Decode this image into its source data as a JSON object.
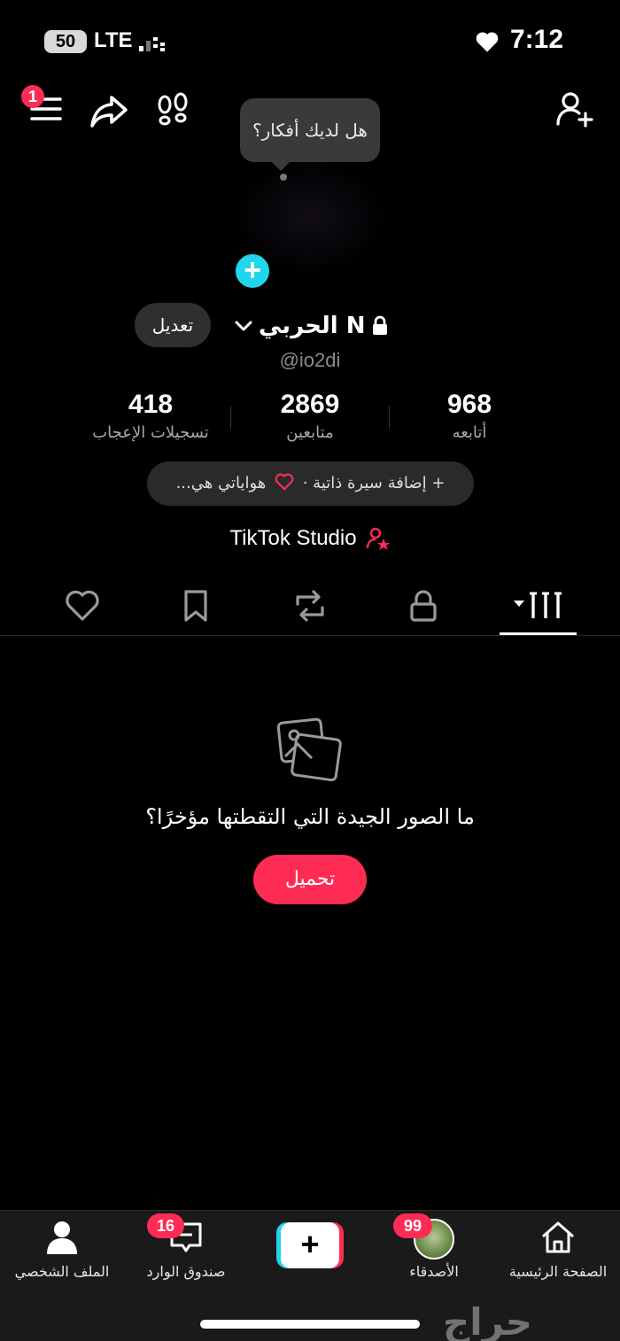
{
  "status_bar": {
    "battery": "50",
    "network": "LTE",
    "time": "7:12"
  },
  "top_bar": {
    "menu_badge": "1"
  },
  "tooltip": {
    "text": "هل لديك أفكار؟"
  },
  "profile": {
    "edit_label": "تعديل",
    "name": "الحربي N",
    "handle": "@io2di"
  },
  "stats": [
    {
      "value": "968",
      "label": "أتابعه"
    },
    {
      "value": "2869",
      "label": "متابعين"
    },
    {
      "value": "418",
      "label": "تسجيلات الإعجاب"
    }
  ],
  "bio_button": {
    "add": "+ إضافة سيرة ذاتية ·",
    "hobbies": "هواياتي هي..."
  },
  "studio": {
    "label": "TikTok Studio"
  },
  "tabs": [
    "videos-grid",
    "private",
    "reposts",
    "saved",
    "liked"
  ],
  "empty_state": {
    "text": "ما الصور الجيدة التي التقطتها مؤخرًا؟",
    "upload_label": "تحميل"
  },
  "bottom_nav": {
    "home": "الصفحة الرئيسية",
    "friends": "الأصدقاء",
    "friends_badge": "99",
    "inbox": "صندوق الوارد",
    "inbox_badge": "16",
    "profile": "الملف الشخصي"
  },
  "watermark": "حراج",
  "colors": {
    "accent": "#fe2c55",
    "cyan": "#20d5ec",
    "background": "#000000"
  }
}
